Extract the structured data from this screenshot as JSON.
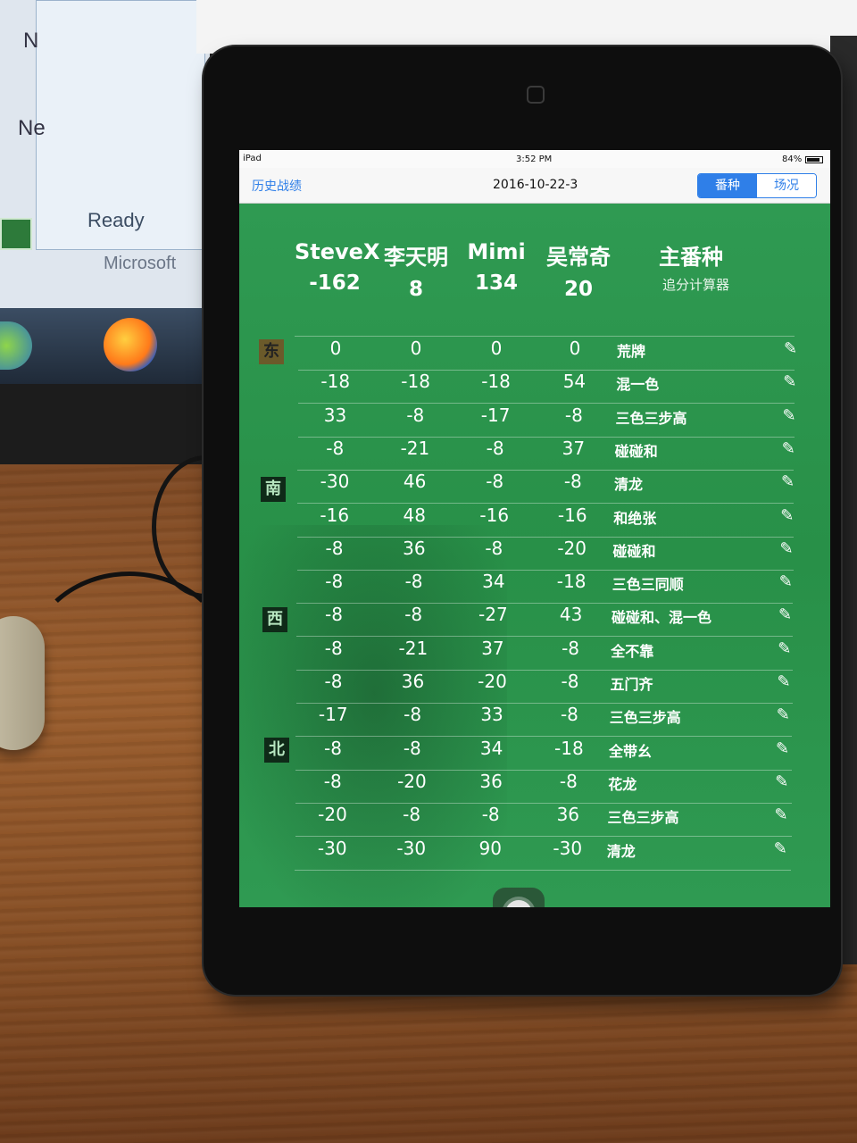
{
  "background": {
    "monitor": {
      "ready_text": "Ready",
      "microsoft_text": "Microsoft",
      "ne_text": "Ne",
      "n_text": "N"
    }
  },
  "statusbar": {
    "device": "iPad",
    "time": "3:52 PM",
    "battery": "84%"
  },
  "navbar": {
    "history_link": "历史战绩",
    "title": "2016-10-22-3",
    "segments": [
      "番种",
      "场况"
    ]
  },
  "header": {
    "players": [
      {
        "name": "SteveX",
        "score": "-162"
      },
      {
        "name": "李天明",
        "score": "8"
      },
      {
        "name": "Mimi",
        "score": "134"
      },
      {
        "name": "吴常奇",
        "score": "20"
      }
    ],
    "main_fan": "主番种",
    "calc_link": "追分计算器"
  },
  "winds": [
    "东",
    "南",
    "西",
    "北"
  ],
  "rounds": [
    {
      "scores": [
        "0",
        "0",
        "0",
        "0"
      ],
      "fan": "荒牌"
    },
    {
      "scores": [
        "-18",
        "-18",
        "-18",
        "54"
      ],
      "fan": "混一色"
    },
    {
      "scores": [
        "33",
        "-8",
        "-17",
        "-8"
      ],
      "fan": "三色三步高"
    },
    {
      "scores": [
        "-8",
        "-21",
        "-8",
        "37"
      ],
      "fan": "碰碰和"
    },
    {
      "scores": [
        "-30",
        "46",
        "-8",
        "-8"
      ],
      "fan": "清龙"
    },
    {
      "scores": [
        "-16",
        "48",
        "-16",
        "-16"
      ],
      "fan": "和绝张"
    },
    {
      "scores": [
        "-8",
        "36",
        "-8",
        "-20"
      ],
      "fan": "碰碰和"
    },
    {
      "scores": [
        "-8",
        "-8",
        "34",
        "-18"
      ],
      "fan": "三色三同顺"
    },
    {
      "scores": [
        "-8",
        "-8",
        "-27",
        "43"
      ],
      "fan": "碰碰和、混一色"
    },
    {
      "scores": [
        "-8",
        "-21",
        "37",
        "-8"
      ],
      "fan": "全不靠"
    },
    {
      "scores": [
        "-8",
        "36",
        "-20",
        "-8"
      ],
      "fan": "五门齐"
    },
    {
      "scores": [
        "-17",
        "-8",
        "33",
        "-8"
      ],
      "fan": "三色三步高"
    },
    {
      "scores": [
        "-8",
        "-8",
        "34",
        "-18"
      ],
      "fan": "全带幺"
    },
    {
      "scores": [
        "-8",
        "-20",
        "36",
        "-8"
      ],
      "fan": "花龙"
    },
    {
      "scores": [
        "-20",
        "-8",
        "-8",
        "36"
      ],
      "fan": "三色三步高"
    },
    {
      "scores": [
        "-30",
        "-30",
        "90",
        "-30"
      ],
      "fan": "清龙"
    }
  ],
  "icons": {
    "edit": "pencil-icon",
    "assistive_touch": "assistive-touch-icon",
    "home_camera": "camera-icon"
  },
  "colors": {
    "accent": "#2f7fe8",
    "table_green": "#2f9a52"
  }
}
